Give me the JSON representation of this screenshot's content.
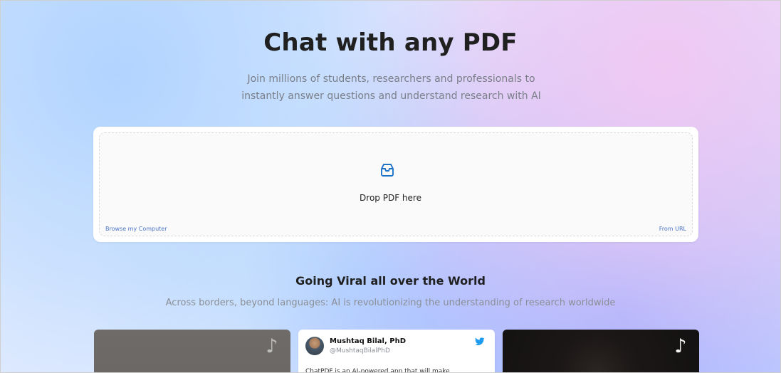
{
  "hero": {
    "title": "Chat with any PDF",
    "subtitle_line1": "Join millions of students, researchers and professionals to",
    "subtitle_line2": "instantly answer questions and understand research with AI"
  },
  "upload": {
    "drop_text": "Drop PDF here",
    "browse_label": "Browse my Computer",
    "url_label": "From URL",
    "icon": "inbox-icon"
  },
  "section": {
    "title": "Going Viral all over the World",
    "subtitle": "Across borders, beyond languages: AI is revolutionizing the understanding of research worldwide"
  },
  "cards": {
    "tiktok_left": {
      "icon": "tiktok-icon",
      "icon_glyph": "♪"
    },
    "tweet": {
      "name": "Mushtaq Bilal, PhD",
      "handle": "@MushtaqBilalPhD",
      "text": "ChatPDF is an AI-powered app that will make",
      "icon": "twitter-icon",
      "accent_color": "#1d9bf0"
    },
    "tiktok_right": {
      "icon": "tiktok-icon",
      "icon_glyph": "♪"
    }
  },
  "colors": {
    "link": "#4b73c4",
    "title": "#202020",
    "muted": "#7a7f88",
    "upload_icon": "#1f73c7"
  }
}
